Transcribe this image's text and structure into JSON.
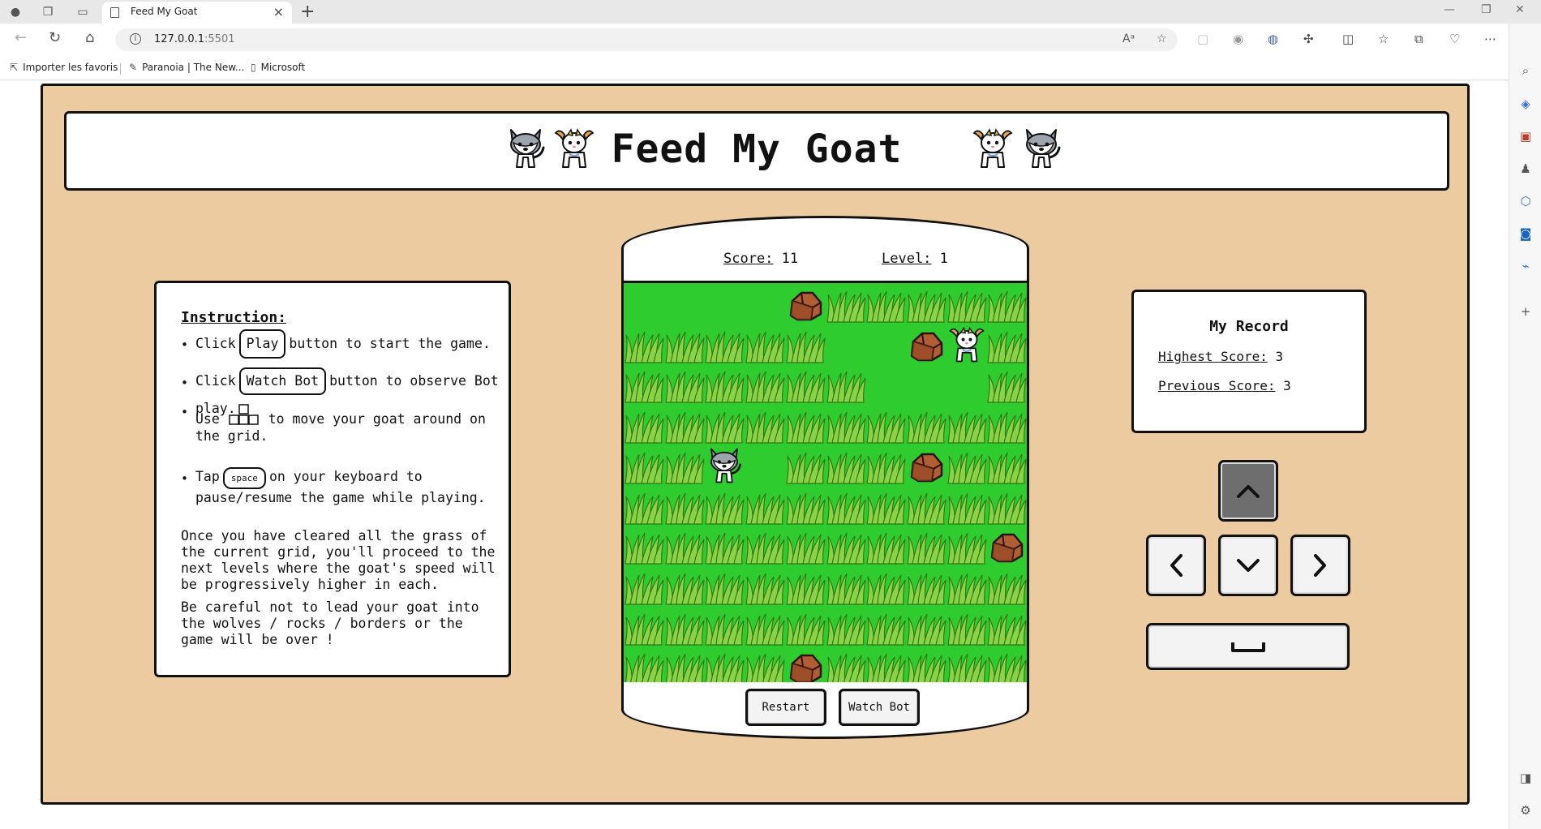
{
  "browser": {
    "tab_title": "Feed My Goat",
    "url_host": "127.0.0.1",
    "url_port": ":5501",
    "bookmarks": [
      "Importer les favoris",
      "Paranoia | The New...",
      "Microsoft"
    ]
  },
  "game": {
    "title": "Feed My Goat",
    "score_label": "Score:",
    "score_value": "11",
    "level_label": "Level:",
    "level_value": "1",
    "restart_label": "Restart",
    "watch_bot_label": "Watch Bot"
  },
  "instructions": {
    "title": "Instruction:",
    "item1_pre": "Click",
    "item1_key": "Play",
    "item1_post": "button to start the game.",
    "item2_pre": "Click",
    "item2_key": "Watch Bot",
    "item2_post": "button to observe Bot play.",
    "item3_pre": "Use",
    "item3_post": "to move your goat around on the grid.",
    "item4_pre": "Tap",
    "item4_key": "space",
    "item4_post": "on your keyboard to pause/resume the game while playing.",
    "para1": "Once you have cleared all the grass of the current grid, you'll proceed to the next levels where the goat's speed will be progressively higher in each.",
    "para2": "Be careful not to lead your goat into the wolves / rocks / borders or the game will be over !"
  },
  "record": {
    "title": "My Record",
    "highest_label": "Highest Score:",
    "highest_value": "3",
    "previous_label": "Previous Score:",
    "previous_value": "3"
  },
  "grid": {
    "cols": 10,
    "rows": 10,
    "rows_map": [
      "....RGGGGG",
      "GGGGG..RLG",
      "GGGGGG...G",
      "GGGGGGGGGG",
      "GGW.GGGRGG",
      "GGGGGGGGGG",
      "GGGGGGGGGR",
      "GGGGGGGGGG",
      "GGGGGGGGGG",
      "GGGGRGGGGG"
    ],
    "legend": {
      "G": "grass",
      "R": "rock",
      "W": "wolf",
      "L": "goat",
      ".": "empty"
    }
  },
  "colors": {
    "background": "#ebcb9f",
    "grid_green": "#2ecc2e",
    "grass": "#7ccf3c",
    "rock": "#a5562e"
  }
}
